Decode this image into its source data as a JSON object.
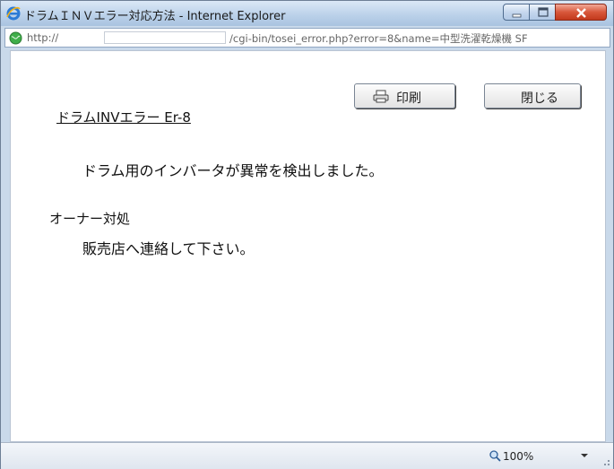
{
  "window": {
    "title": "ドラムＩＮＶエラー対応方法 - Internet Explorer"
  },
  "address": {
    "scheme": "http://",
    "path": "/cgi-bin/tosei_error.php?error=8&name=中型洗濯乾燥機 SF"
  },
  "buttons": {
    "print_label": "印刷",
    "close_label": "閉じる"
  },
  "content": {
    "error_title": "ドラムINVエラー Er-8",
    "message": "ドラム用のインバータが異常を検出しました。",
    "owner_heading": "オーナー対処",
    "owner_action": "販売店へ連絡して下さい。"
  },
  "statusbar": {
    "zoom": "100%"
  },
  "colors": {
    "titlebar": "#bcd2ea",
    "close_button": "#c2391c",
    "frame": "#c9d9ea"
  }
}
